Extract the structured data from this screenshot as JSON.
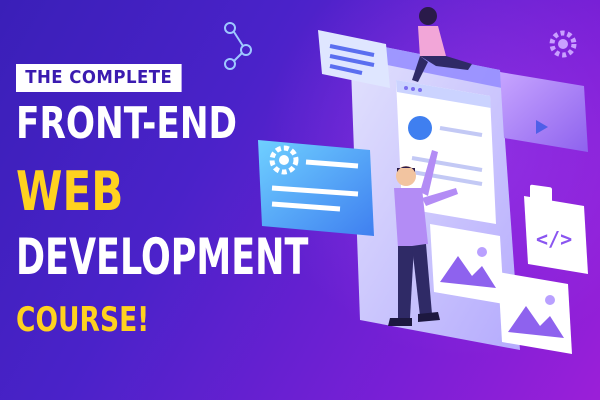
{
  "headline": {
    "eyebrow": "THE COMPLETE",
    "line1": "FRONT-END",
    "line2": "WEB",
    "line3": "DEVELOPMENT",
    "line4": "COURSE!"
  },
  "code_badge": "</>",
  "colors": {
    "accent_yellow": "#ffd21f",
    "panel_white": "#ffffff",
    "panel_blue": "#4fb0f5",
    "panel_purple": "#a07bf2"
  },
  "icons": [
    "share-icon",
    "gear-icon",
    "play-icon",
    "image-icon",
    "code-icon"
  ]
}
